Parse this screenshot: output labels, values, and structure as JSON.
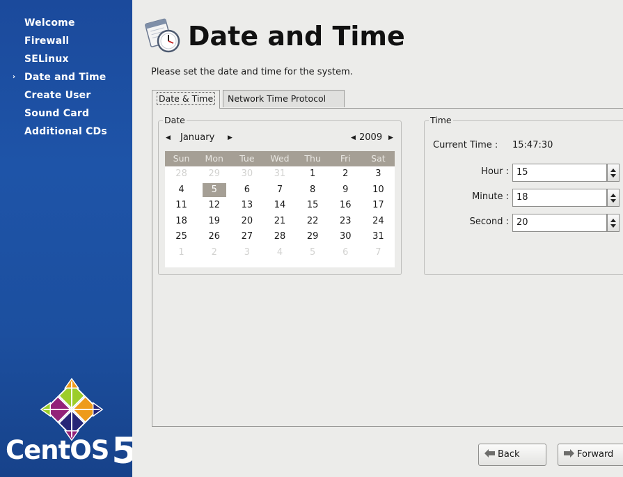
{
  "sidebar": {
    "items": [
      {
        "label": "Welcome",
        "active": false
      },
      {
        "label": "Firewall",
        "active": false
      },
      {
        "label": "SELinux",
        "active": false
      },
      {
        "label": "Date and Time",
        "active": true
      },
      {
        "label": "Create User",
        "active": false
      },
      {
        "label": "Sound Card",
        "active": false
      },
      {
        "label": "Additional CDs",
        "active": false
      }
    ],
    "active_marker": "›",
    "logo": {
      "text": "CentOS",
      "version": "5"
    }
  },
  "header": {
    "icon": "clock-calendar-icon",
    "title": "Date and Time",
    "subtitle": "Please set the date and time for the system."
  },
  "tabs": [
    {
      "label": "Date & Time",
      "selected": true
    },
    {
      "label": "Network Time Protocol",
      "selected": false
    }
  ],
  "date": {
    "frame_label": "Date",
    "month": "January",
    "year": "2009",
    "weekdays": [
      "Sun",
      "Mon",
      "Tue",
      "Wed",
      "Thu",
      "Fri",
      "Sat"
    ],
    "weeks": [
      [
        {
          "d": "28",
          "o": true
        },
        {
          "d": "29",
          "o": true
        },
        {
          "d": "30",
          "o": true
        },
        {
          "d": "31",
          "o": true
        },
        {
          "d": "1"
        },
        {
          "d": "2"
        },
        {
          "d": "3"
        }
      ],
      [
        {
          "d": "4"
        },
        {
          "d": "5",
          "sel": true
        },
        {
          "d": "6"
        },
        {
          "d": "7"
        },
        {
          "d": "8"
        },
        {
          "d": "9"
        },
        {
          "d": "10"
        }
      ],
      [
        {
          "d": "11"
        },
        {
          "d": "12"
        },
        {
          "d": "13"
        },
        {
          "d": "14"
        },
        {
          "d": "15"
        },
        {
          "d": "16"
        },
        {
          "d": "17"
        }
      ],
      [
        {
          "d": "18"
        },
        {
          "d": "19"
        },
        {
          "d": "20"
        },
        {
          "d": "21"
        },
        {
          "d": "22"
        },
        {
          "d": "23"
        },
        {
          "d": "24"
        }
      ],
      [
        {
          "d": "25"
        },
        {
          "d": "26"
        },
        {
          "d": "27"
        },
        {
          "d": "28"
        },
        {
          "d": "29"
        },
        {
          "d": "30"
        },
        {
          "d": "31"
        }
      ],
      [
        {
          "d": "1",
          "o": true
        },
        {
          "d": "2",
          "o": true
        },
        {
          "d": "3",
          "o": true
        },
        {
          "d": "4",
          "o": true
        },
        {
          "d": "5",
          "o": true
        },
        {
          "d": "6",
          "o": true
        },
        {
          "d": "7",
          "o": true
        }
      ]
    ],
    "selected_day": "5"
  },
  "time": {
    "frame_label": "Time",
    "current_label": "Current Time :",
    "current_value": "15:47:30",
    "hour_label": "Hour :",
    "hour_value": "15",
    "minute_label": "Minute :",
    "minute_value": "18",
    "second_label": "Second :",
    "second_value": "20"
  },
  "buttons": {
    "back": "Back",
    "forward": "Forward"
  },
  "colors": {
    "sidebar": "#1e54a8",
    "calendar_header": "#a59f95",
    "selected_day": "#a59f95",
    "window_bg": "#ececea"
  }
}
